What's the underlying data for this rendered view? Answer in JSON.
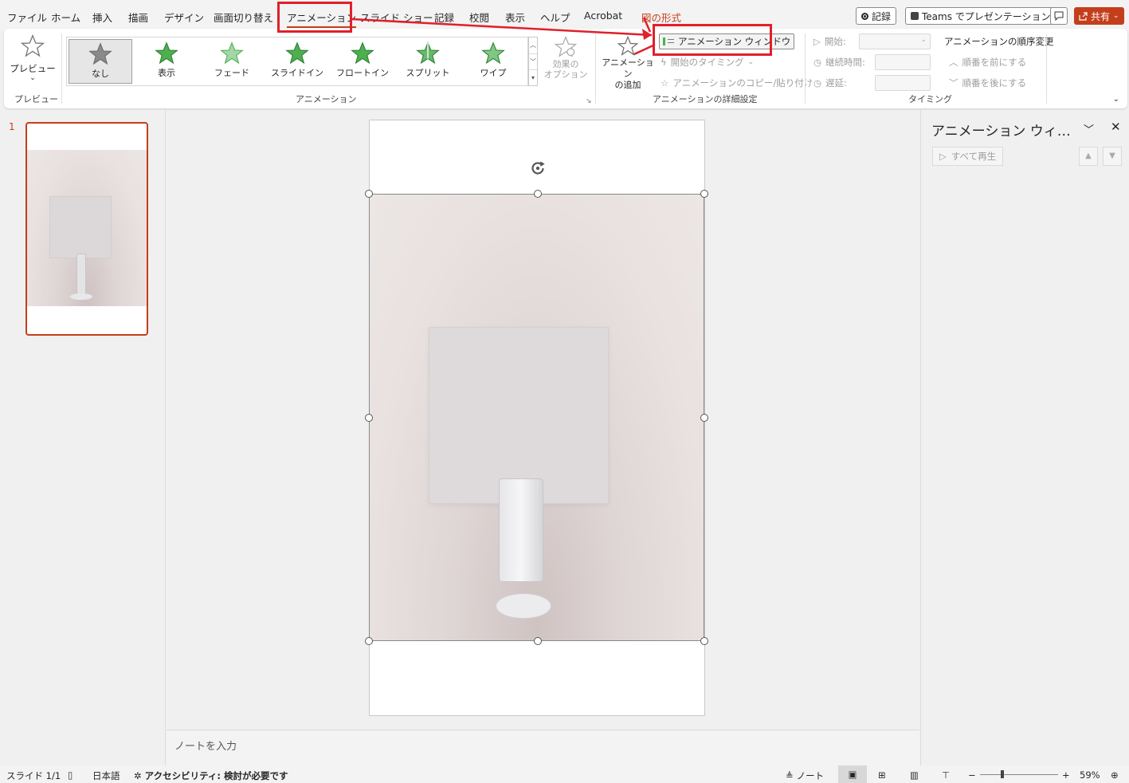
{
  "menu": {
    "tabs": [
      "ファイル",
      "ホーム",
      "挿入",
      "描画",
      "デザイン",
      "画面切り替え",
      "アニメーション",
      "スライド ショー",
      "記録",
      "校閲",
      "表示",
      "ヘルプ",
      "Acrobat",
      "図の形式"
    ],
    "record_button": "記録",
    "teams_button": "Teams でプレゼンテーション",
    "share_button": "共有"
  },
  "ribbon": {
    "preview_label": "プレビュー",
    "preview_group": "プレビュー",
    "gallery_items": [
      "なし",
      "表示",
      "フェード",
      "スライドイン",
      "フロートイン",
      "スプリット",
      "ワイプ"
    ],
    "effect_options": "効果の\nオプション",
    "animation_group": "アニメーション",
    "add_animation": "アニメーション\nの追加",
    "anim_window": "アニメーション ウィンドウ",
    "start_timing": "開始のタイミング",
    "copy_anim": "アニメーションのコピー/貼り付け",
    "advanced_group": "アニメーションの詳細設定",
    "start_label": "開始:",
    "duration_label": "継続時間:",
    "delay_label": "遅延:",
    "reorder_title": "アニメーションの順序変更",
    "move_earlier": "順番を前にする",
    "move_later": "順番を後にする",
    "timing_group": "タイミング"
  },
  "thumbnails": {
    "number": "1"
  },
  "notes": {
    "placeholder": "ノートを入力"
  },
  "anim_pane": {
    "title": "アニメーション ウィ…",
    "play_all": "すべて再生"
  },
  "status": {
    "slide": "スライド 1/1",
    "language": "日本語",
    "accessibility": "アクセシビリティ: 検討が必要です",
    "notes": "ノート",
    "zoom": "59%"
  },
  "colors": {
    "accent": "#c43e1c",
    "highlight": "#e0202a"
  }
}
